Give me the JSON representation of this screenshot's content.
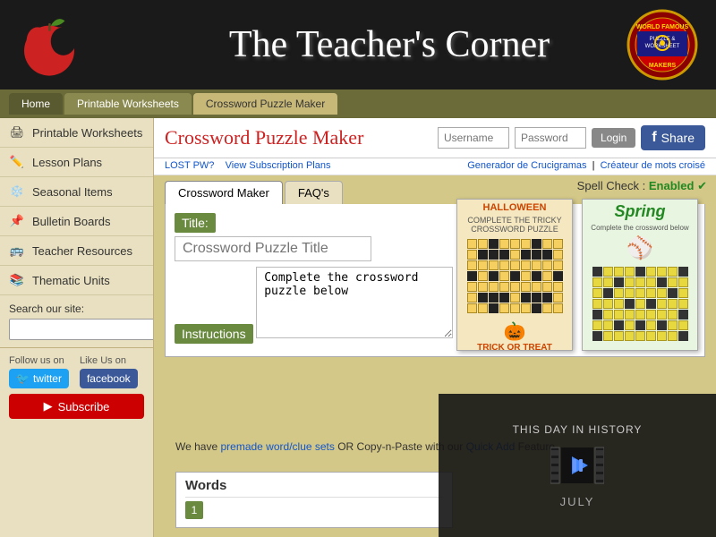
{
  "header": {
    "title": "The Teacher's Corner",
    "badge_alt": "World Famous Puzzle & Worksheet Makers"
  },
  "navbar": {
    "items": [
      {
        "label": "Home",
        "active": false
      },
      {
        "label": "Printable Worksheets",
        "active": false
      },
      {
        "label": "Crossword Puzzle Maker",
        "active": true
      }
    ]
  },
  "sidebar": {
    "items": [
      {
        "label": "Printable Worksheets",
        "icon": "printer-icon"
      },
      {
        "label": "Lesson Plans",
        "icon": "pencil-icon"
      },
      {
        "label": "Seasonal Items",
        "icon": "snowflake-icon"
      },
      {
        "label": "Bulletin Boards",
        "icon": "pin-icon"
      },
      {
        "label": "Teacher Resources",
        "icon": "bus-icon"
      },
      {
        "label": "Thematic Units",
        "icon": "book-icon"
      }
    ],
    "search": {
      "label": "Search our site:",
      "placeholder": ""
    },
    "follow": {
      "follow_label": "Follow us on",
      "like_label": "Like Us on",
      "twitter_label": "twitter",
      "facebook_label": "facebook",
      "subscribe_label": "▶  Subscribe"
    }
  },
  "page": {
    "title": "Crossword Puzzle Maker",
    "login": {
      "username_placeholder": "Username",
      "password_placeholder": "Password",
      "login_btn": "Login",
      "lost_pw": "LOST PW?",
      "subscription_link": "View Subscription Plans"
    },
    "share": {
      "label": "Share",
      "icon": "f"
    },
    "links": {
      "generador": "Generador de Crucigramas",
      "createur": "Créateur de mots croisé"
    },
    "spell_check": {
      "label": "Spell Check :",
      "status": "Enabled"
    },
    "tabs": [
      {
        "label": "Crossword Maker",
        "active": true
      },
      {
        "label": "FAQ's",
        "active": false
      }
    ],
    "form": {
      "title_label": "Title:",
      "title_placeholder": "Crossword Puzzle Title",
      "instructions_label": "Instructions",
      "instructions_value": "Complete the crossword puzzle below"
    },
    "info_text": "We have ",
    "premade_link": "premade word/clue sets",
    "info_text2": " OR Copy-n-Paste with our ",
    "quick_add_link": "Quick Add",
    "info_text3": " Feature",
    "words": {
      "title": "Words",
      "row_num": "1"
    }
  },
  "history": {
    "title": "THIS DAY IN HISTORY",
    "date": "JULY"
  }
}
